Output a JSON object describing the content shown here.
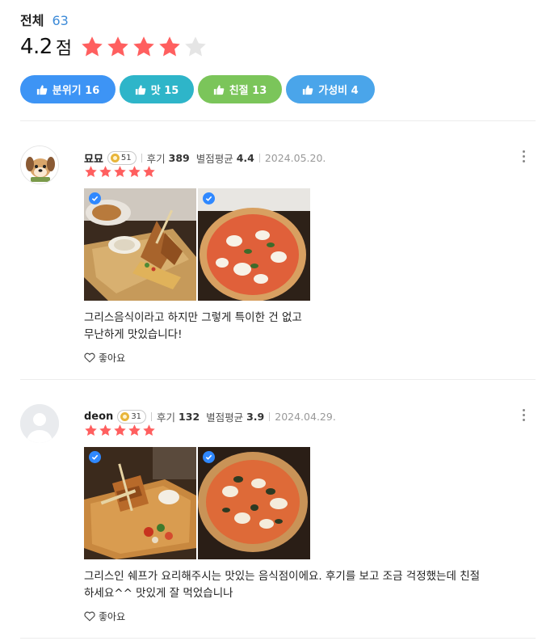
{
  "summary": {
    "total_label": "전체",
    "total_count": "63",
    "score": "4.2",
    "score_unit": "점",
    "rating": 4.2,
    "star_color": "#ff5f5f",
    "star_empty_color": "#e5e5e5"
  },
  "chips": [
    {
      "label": "분위기 16",
      "icon": "thumbs-up-icon",
      "color": "#3d94f5"
    },
    {
      "label": "맛 15",
      "icon": "thumbs-up-icon",
      "color": "#2eb5c9"
    },
    {
      "label": "친절 13",
      "icon": "thumbs-up-icon",
      "color": "#7bc55a"
    },
    {
      "label": "가성비 4",
      "icon": "thumbs-up-icon",
      "color": "#4aa5ea"
    }
  ],
  "reviews": [
    {
      "nickname": "묘묘",
      "level": "51",
      "review_label": "후기",
      "review_count": "389",
      "avg_label": "별점평균",
      "avg_score": "4.4",
      "date": "2024.05.20.",
      "rating": 5,
      "text_line1": "그리스음식이라고 하지만 그렇게 특이한 건 없고",
      "text_line2": "무난하게 맛있습니다!",
      "like_label": "좋아요",
      "avatar": "dog-avatar-icon"
    },
    {
      "nickname": "deon",
      "level": "31",
      "review_label": "후기",
      "review_count": "132",
      "avg_label": "별점평균",
      "avg_score": "3.9",
      "date": "2024.04.29.",
      "rating": 5,
      "text_line1": "그리스인 쉐프가 요리해주시는 맛있는 음식점이에요. 후기를 보고 조금 걱정했는데 친절",
      "text_line2": "하세요^^ 맛있게 잘 먹었습니나",
      "like_label": "좋아요",
      "avatar": "default-user-avatar-icon"
    }
  ]
}
